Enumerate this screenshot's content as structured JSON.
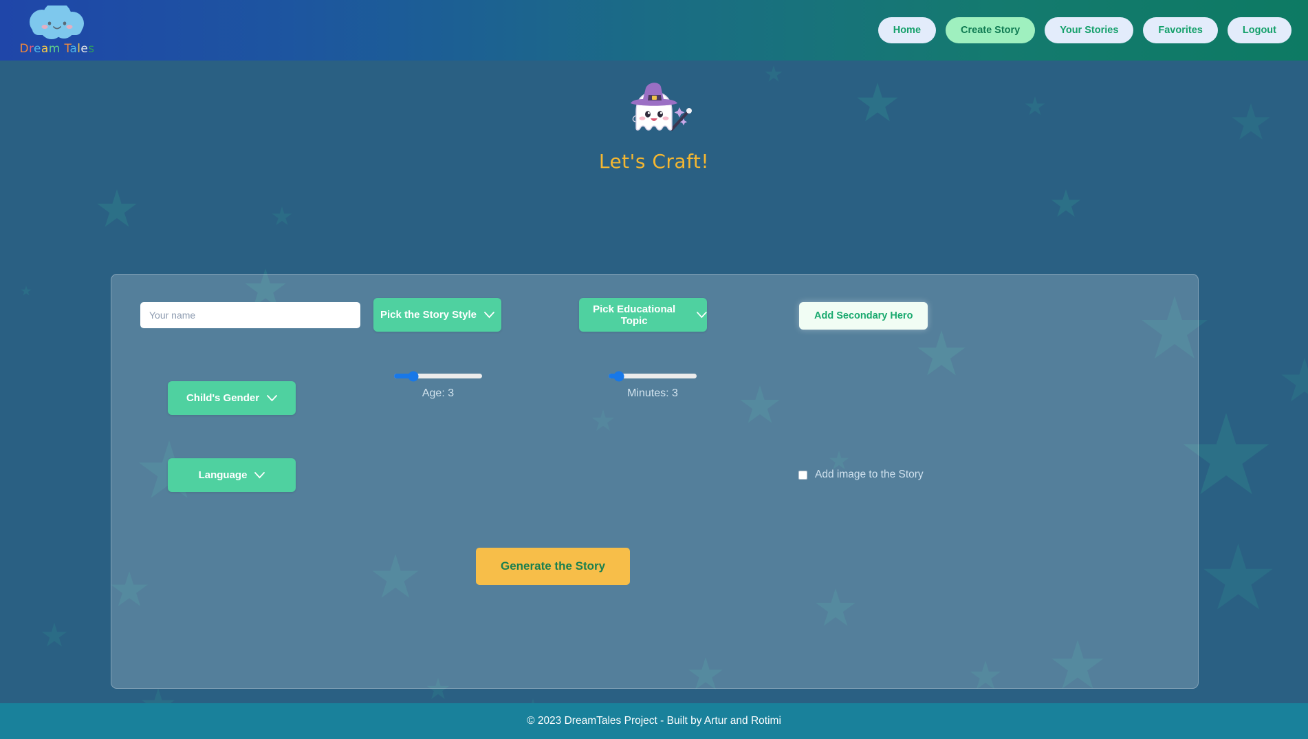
{
  "brand": {
    "name": "DreamTales",
    "letters": [
      "D",
      "r",
      "e",
      "a",
      "m",
      " ",
      "T",
      "a",
      "l",
      "e",
      "s"
    ],
    "logo_icon": "smiling-cloud-icon"
  },
  "nav": {
    "items": [
      {
        "label": "Home",
        "active": false
      },
      {
        "label": "Create Story",
        "active": true
      },
      {
        "label": "Your Stories",
        "active": false
      },
      {
        "label": "Favorites",
        "active": false
      },
      {
        "label": "Logout",
        "active": false
      }
    ]
  },
  "hero": {
    "icon": "ghost-wizard-icon",
    "title": "Let's Craft!",
    "title_color": "#f5b731"
  },
  "form": {
    "name_input": {
      "value": "",
      "placeholder": "Your name"
    },
    "story_style": {
      "label": "Pick the Story Style"
    },
    "educational_topic": {
      "label": "Pick Educational Topic"
    },
    "secondary_hero": {
      "label": "Add Secondary Hero"
    },
    "child_gender": {
      "label": "Child's Gender"
    },
    "language": {
      "label": "Language"
    },
    "age_slider": {
      "label": "Age: 3",
      "value": 3,
      "min": 1,
      "max": 12,
      "percent": 22
    },
    "minutes_slider": {
      "label": "Minutes: 3",
      "value": 3,
      "min": 1,
      "max": 20,
      "percent": 12
    },
    "add_image": {
      "label": "Add image to the Story",
      "checked": false
    },
    "generate": {
      "label": "Generate the Story"
    }
  },
  "footer": {
    "text": "© 2023 DreamTales Project - Built by Artur and Rotimi"
  },
  "colors": {
    "header_gradient_start": "#1f46a9",
    "header_gradient_end": "#0d7a63",
    "page_background": "#2a6083",
    "star": "#2d7f8c",
    "accent_green": "#4fd1a0",
    "accent_amber": "#f7be49",
    "nav_pill": "#e3ecfb",
    "nav_pill_active": "#9ff0bf",
    "slider_blue": "#1878e8",
    "footer_background": "#19819b"
  }
}
